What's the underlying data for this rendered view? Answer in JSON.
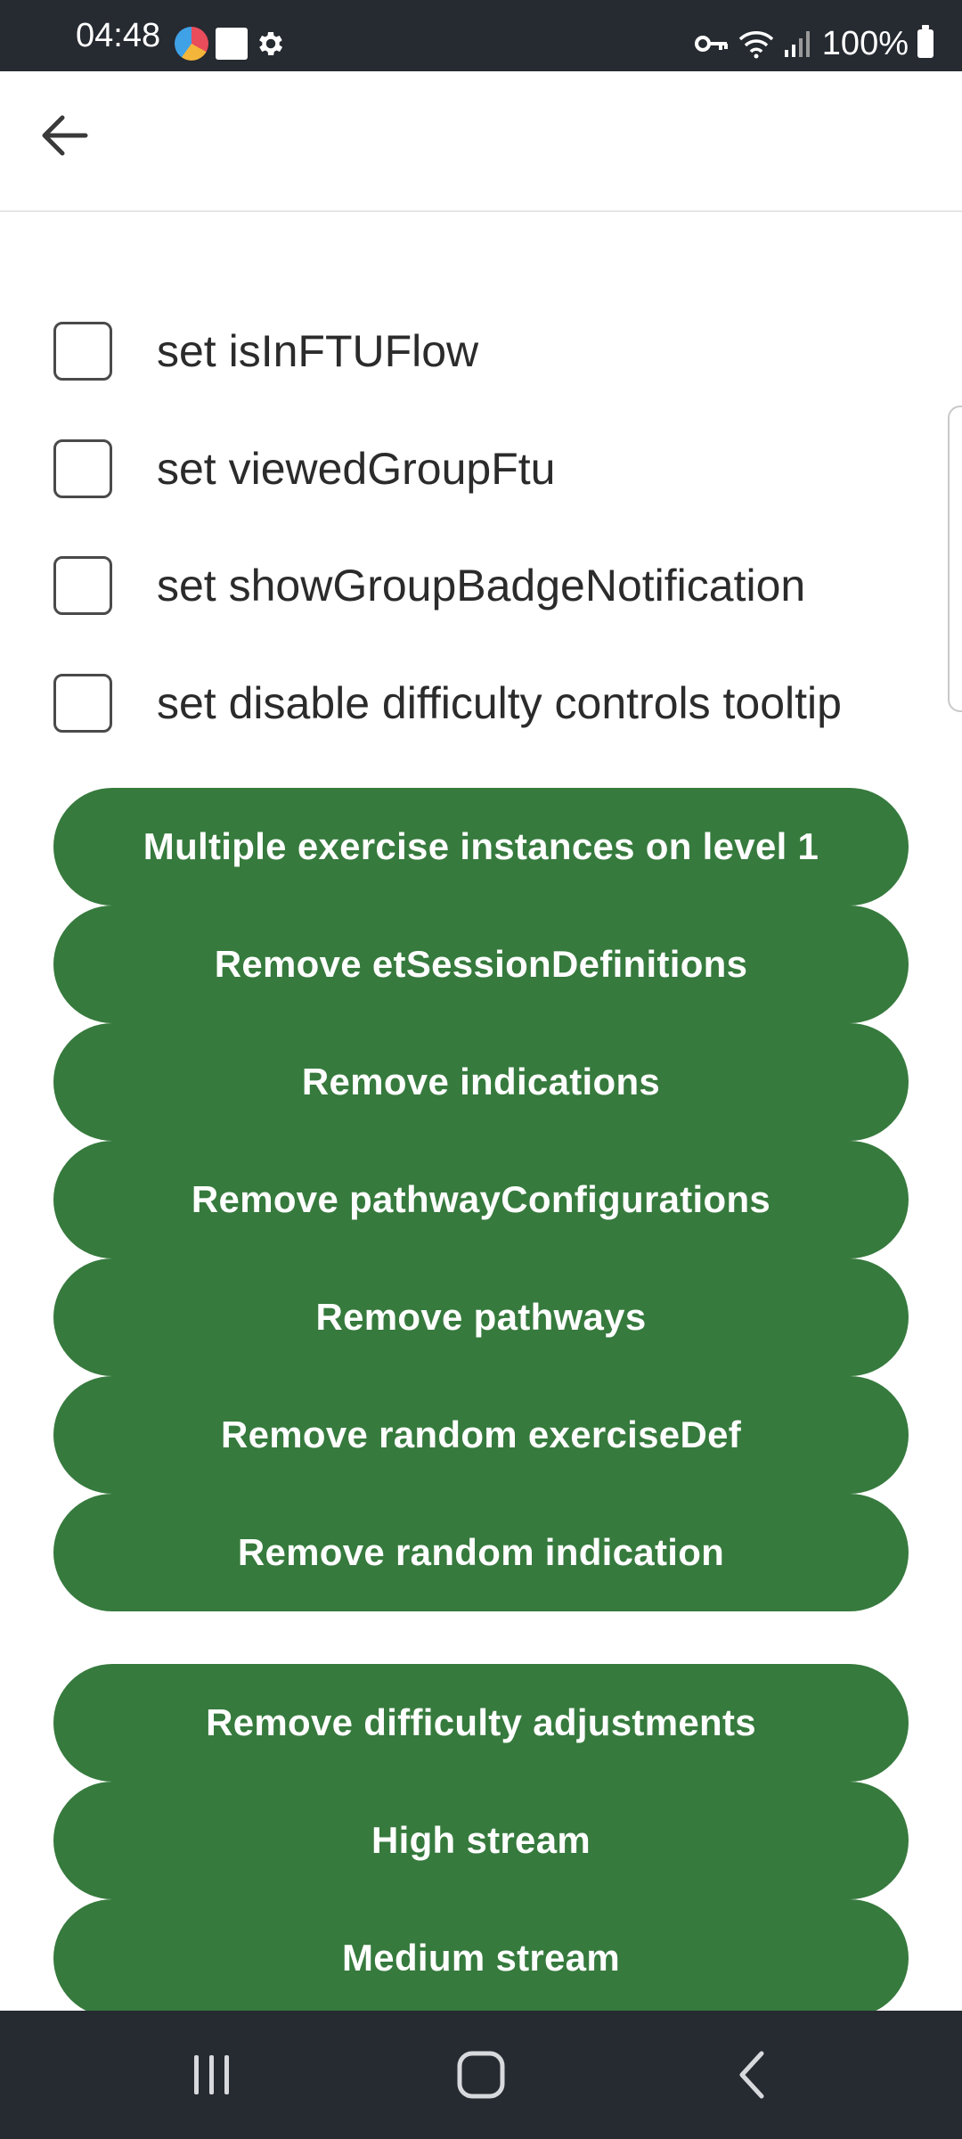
{
  "status_bar": {
    "time": "04:48",
    "battery": "100%"
  },
  "checkboxes": [
    {
      "label": "set isInFTUFlow",
      "checked": false
    },
    {
      "label": "set viewedGroupFtu",
      "checked": false
    },
    {
      "label": "set showGroupBadgeNotification",
      "checked": false
    },
    {
      "label": "set disable difficulty controls tooltip",
      "checked": false
    }
  ],
  "buttons": [
    {
      "label": "Multiple exercise instances on level 1"
    },
    {
      "label": "Remove etSessionDefinitions"
    },
    {
      "label": "Remove indications"
    },
    {
      "label": "Remove pathwayConfigurations"
    },
    {
      "label": "Remove pathways"
    },
    {
      "label": "Remove random exerciseDef"
    },
    {
      "label": "Remove random indication"
    },
    {
      "label": "Remove difficulty adjustments"
    },
    {
      "label": "High stream"
    },
    {
      "label": "Medium stream"
    }
  ],
  "colors": {
    "accent_green": "#367a3d",
    "system_bars": "#262a31"
  },
  "icons": {
    "back": "arrow-left-icon",
    "nav_recents": "recents-icon",
    "nav_home": "home-icon",
    "nav_back": "chevron-left-icon"
  }
}
